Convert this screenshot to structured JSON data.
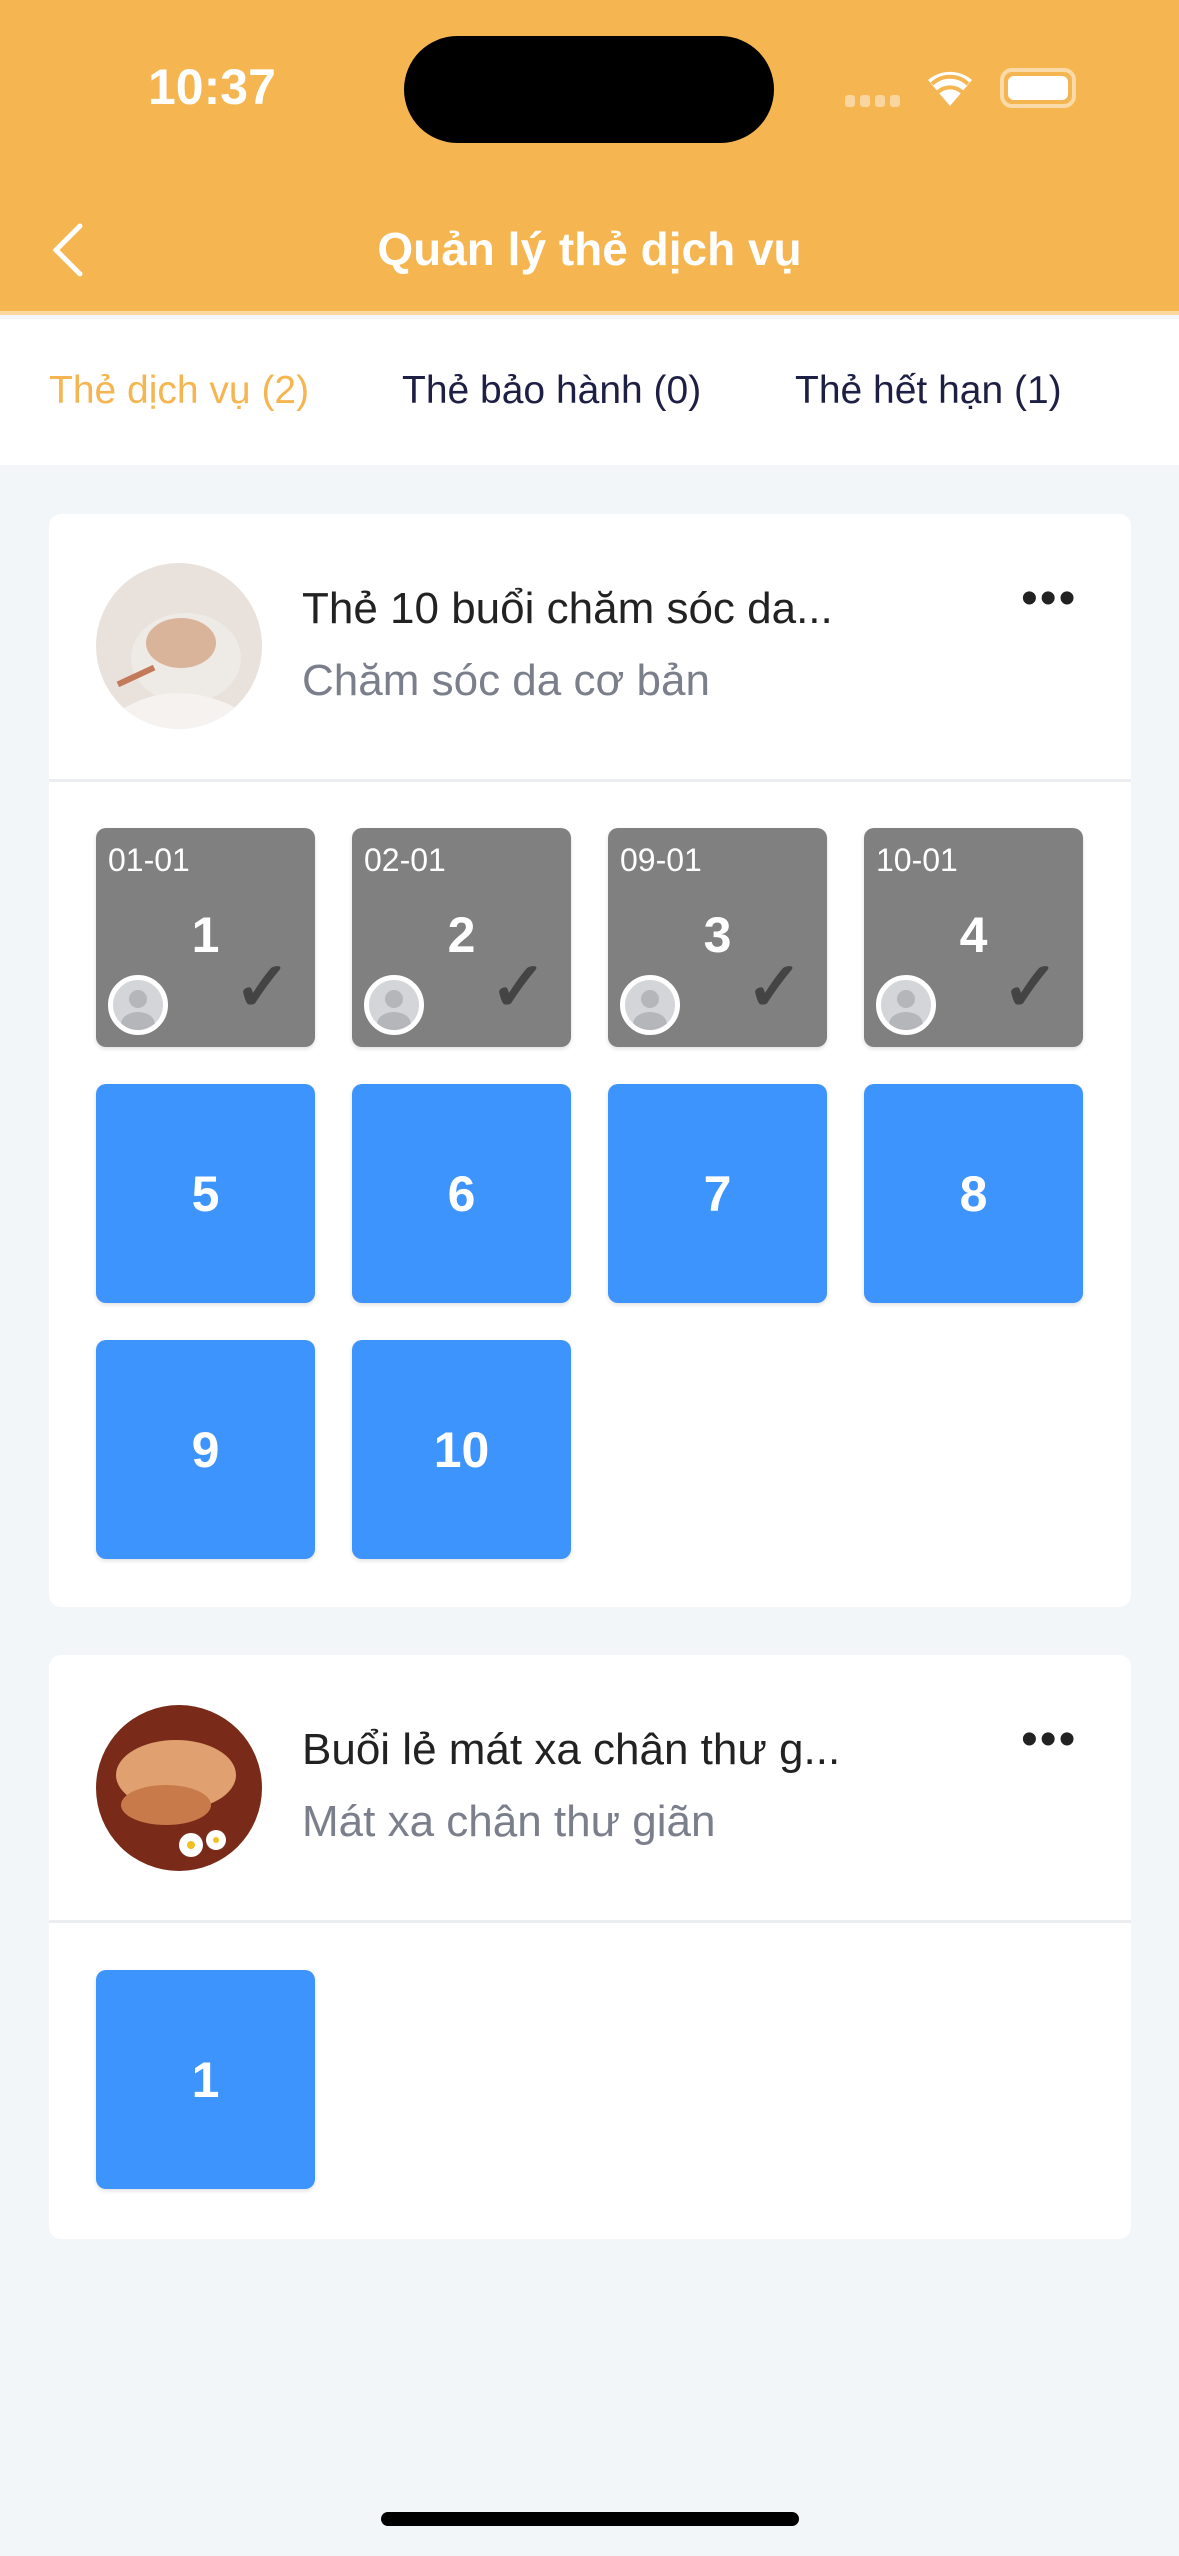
{
  "status_bar": {
    "time": "10:37"
  },
  "header": {
    "title": "Quản lý thẻ dịch vụ",
    "back_icon": "chevron-left-icon"
  },
  "colors": {
    "brand": "#f5b550",
    "available": "#3c94fc",
    "used": "#808080",
    "tab_inactive": "#1e1f45"
  },
  "tabs": [
    {
      "label": "Thẻ dịch vụ (2)",
      "active": true
    },
    {
      "label": "Thẻ bảo hành (0)",
      "active": false
    },
    {
      "label": "Thẻ hết hạn (1)",
      "active": false
    }
  ],
  "cards": [
    {
      "title": "Thẻ 10 buổi chăm sóc da...",
      "subtitle": "Chăm sóc da cơ bản",
      "more": "•••",
      "sessions": [
        {
          "number": "1",
          "date": "01-01",
          "used": true
        },
        {
          "number": "2",
          "date": "02-01",
          "used": true
        },
        {
          "number": "3",
          "date": "09-01",
          "used": true
        },
        {
          "number": "4",
          "date": "10-01",
          "used": true
        },
        {
          "number": "5",
          "used": false
        },
        {
          "number": "6",
          "used": false
        },
        {
          "number": "7",
          "used": false
        },
        {
          "number": "8",
          "used": false
        },
        {
          "number": "9",
          "used": false
        },
        {
          "number": "10",
          "used": false
        }
      ]
    },
    {
      "title": "Buổi lẻ mát xa chân thư g...",
      "subtitle": "Mát xa chân thư giãn",
      "more": "•••",
      "sessions": [
        {
          "number": "1",
          "used": false
        }
      ]
    }
  ]
}
